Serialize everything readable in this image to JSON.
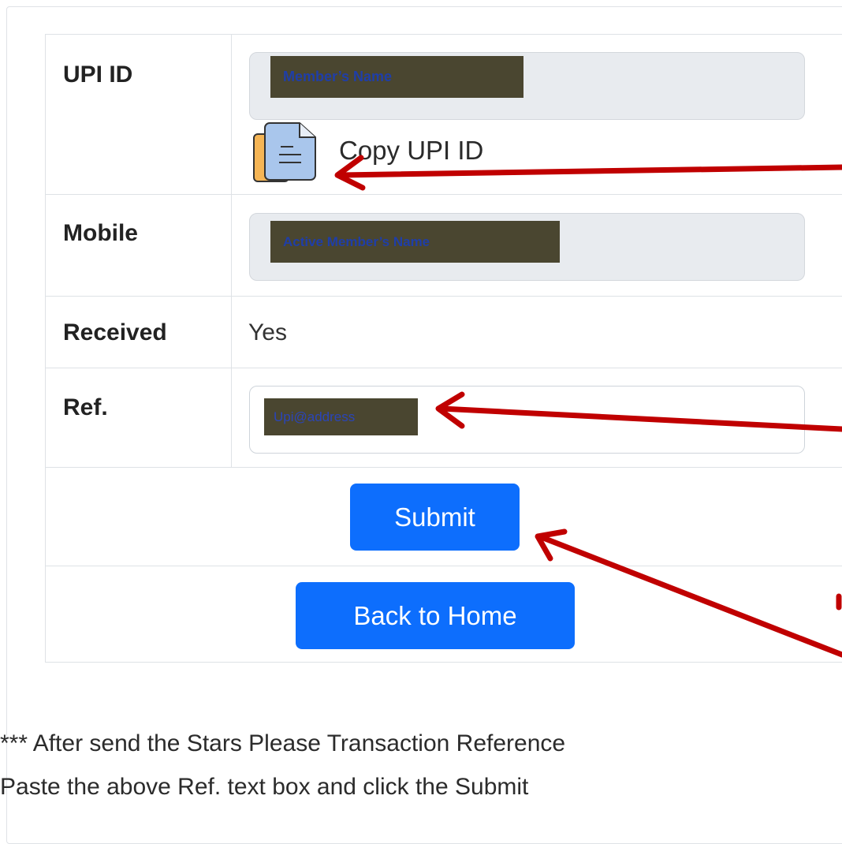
{
  "form": {
    "upi": {
      "label": "UPI ID",
      "mask_text": "Member’s Name",
      "copy_label": "Copy UPI ID",
      "copy_icon": "copy-document-icon"
    },
    "mobile": {
      "label": "Mobile",
      "mask_text": "Active Member’s Name"
    },
    "received": {
      "label": "Received",
      "value": "Yes"
    },
    "ref": {
      "label": "Ref.",
      "mask_text": "Upi@address"
    },
    "submit_label": "Submit",
    "back_label": "Back to Home"
  },
  "notes": {
    "line1": "*** After send the Stars Please Transaction Reference",
    "line2": "Paste the above Ref. text box and click the Submit"
  },
  "colors": {
    "primary": "#0d6efd",
    "annotation_arrow": "#c00000",
    "mask_fill": "#4a4630",
    "mask_text": "#1f3ea8"
  }
}
